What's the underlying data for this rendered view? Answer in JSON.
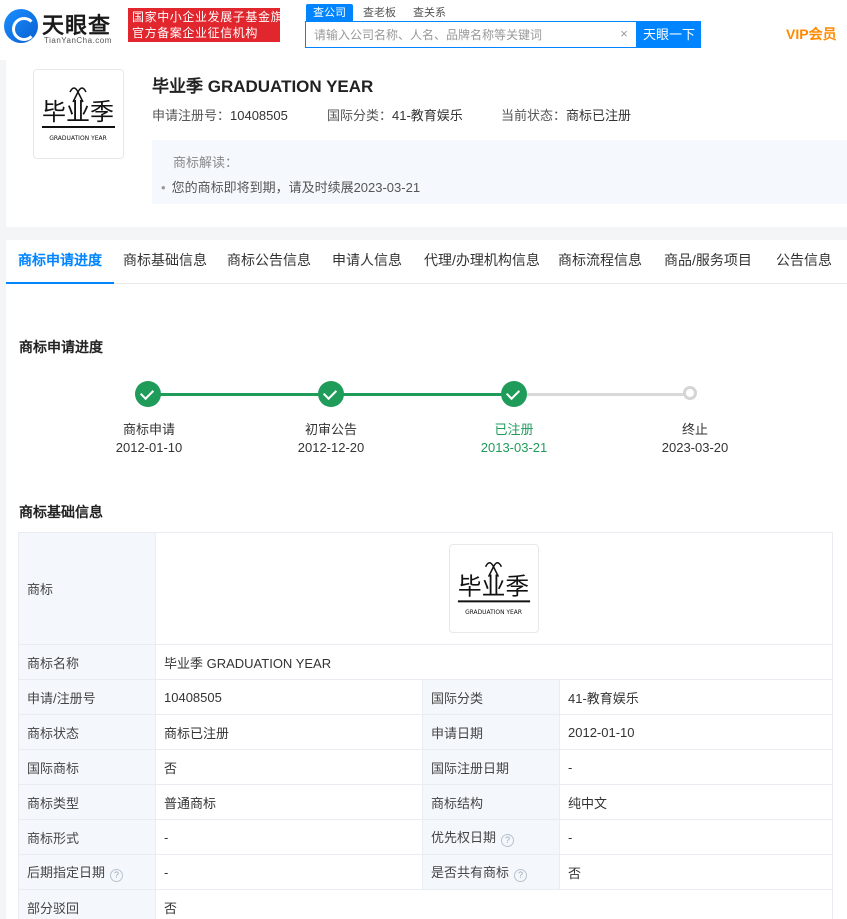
{
  "header": {
    "logo_name": "天眼查",
    "logo_sub": "TianYanCha.com",
    "slogan_line1": "国家中小企业发展子基金旗下",
    "slogan_line2": "官方备案企业征信机构",
    "search_tabs": [
      "查公司",
      "查老板",
      "查关系"
    ],
    "search_placeholder": "请输入公司名称、人名、品牌名称等关键词",
    "search_button": "天眼一下",
    "vip_label": "VIP会员"
  },
  "summary": {
    "title": "毕业季 GRADUATION YEAR",
    "reg_no_label": "申请注册号：",
    "reg_no": "10408505",
    "class_label": "国际分类：",
    "class_value": "41-教育娱乐",
    "status_label": "当前状态：",
    "status_value": "商标已注册",
    "interp_title": "商标解读：",
    "interp_item": "您的商标即将到期，请及时续展2023-03-21"
  },
  "logo_art": {
    "main": "毕业季",
    "sub": "GRADUATION YEAR"
  },
  "tabs": [
    "商标申请进度",
    "商标基础信息",
    "商标公告信息",
    "申请人信息",
    "代理/办理机构信息",
    "商标流程信息",
    "商品/服务项目",
    "公告信息"
  ],
  "progress": {
    "title": "商标申请进度",
    "steps": [
      {
        "label": "商标申请",
        "date": "2012-01-10",
        "state": "done"
      },
      {
        "label": "初审公告",
        "date": "2012-12-20",
        "state": "done"
      },
      {
        "label": "已注册",
        "date": "2013-03-21",
        "state": "current"
      },
      {
        "label": "终止",
        "date": "2023-03-20",
        "state": "pending"
      }
    ],
    "done_color": "#1f9c5a",
    "pending_color": "#d5d5d5"
  },
  "basic": {
    "title": "商标基础信息",
    "logo_label": "商标",
    "name_label": "商标名称",
    "name_value": "毕业季 GRADUATION YEAR",
    "rows": [
      {
        "k1": "申请/注册号",
        "v1": "10408505",
        "k2": "国际分类",
        "v2": "41-教育娱乐"
      },
      {
        "k1": "商标状态",
        "v1": "商标已注册",
        "k2": "申请日期",
        "v2": "2012-01-10"
      },
      {
        "k1": "国际商标",
        "v1": "否",
        "k2": "国际注册日期",
        "v2": "-"
      },
      {
        "k1": "商标类型",
        "v1": "普通商标",
        "k2": "商标结构",
        "v2": "纯中文"
      },
      {
        "k1": "商标形式",
        "v1": "-",
        "k2": "优先权日期",
        "v2": "-"
      },
      {
        "k1": "后期指定日期",
        "v1": "-",
        "k2": "是否共有商标",
        "v2": "否"
      }
    ],
    "last_label": "部分驳回",
    "last_value": "否"
  },
  "accent_color": "#0084ff"
}
